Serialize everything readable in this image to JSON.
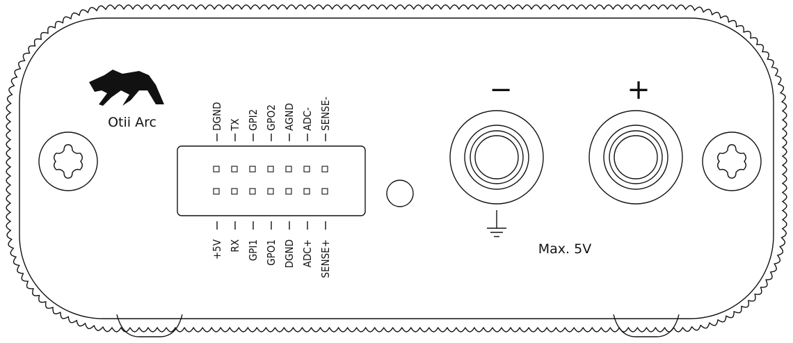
{
  "device": {
    "name": "Otii Arc",
    "max_voltage_label": "Max. 5V",
    "negative_symbol": "−",
    "positive_symbol": "+"
  },
  "connector": {
    "top_labels": [
      "DGND",
      "TX",
      "GPI2",
      "GPO2",
      "AGND",
      "ADC-",
      "SENSE-"
    ],
    "bottom_labels": [
      "+5V",
      "RX",
      "GPI1",
      "GPO1",
      "DGND",
      "ADC+",
      "SENSE+"
    ]
  },
  "icons": {
    "logo": "bear-logo-icon",
    "left_screw": "torx-screw-icon",
    "right_screw": "torx-screw-icon",
    "ground": "ground-symbol-icon"
  },
  "colors": {
    "stroke": "#111111",
    "background": "#ffffff"
  }
}
